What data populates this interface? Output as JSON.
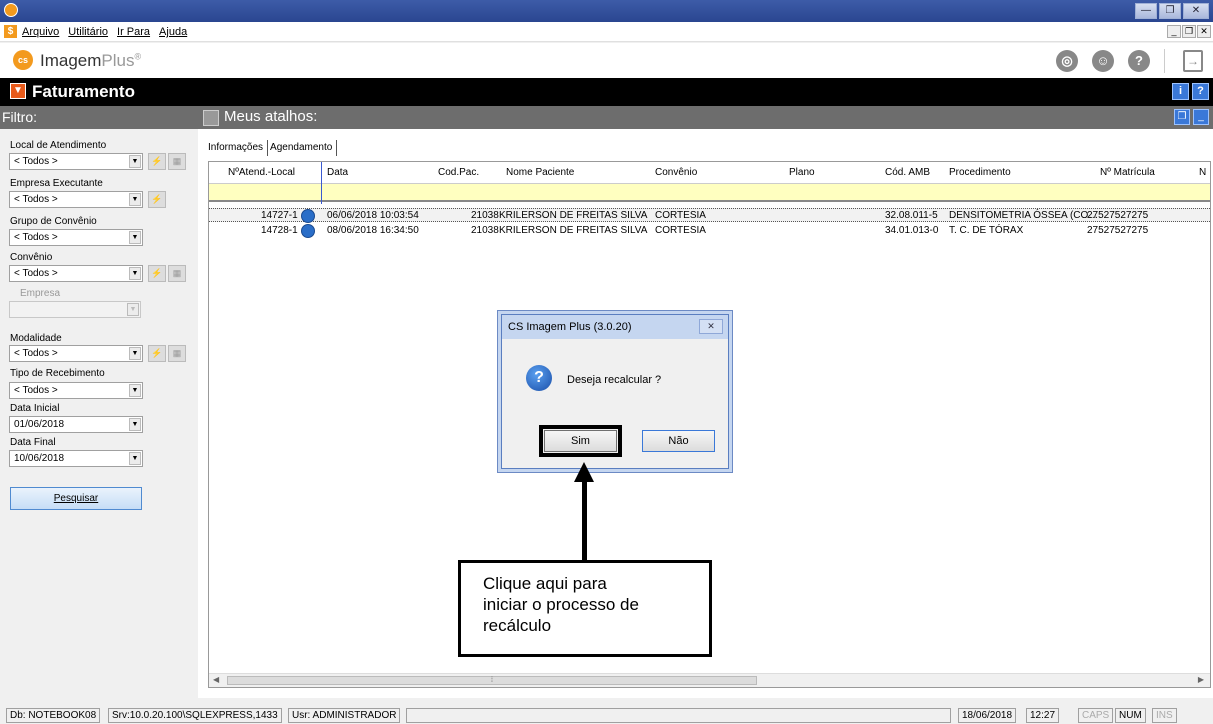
{
  "menu": {
    "items": [
      "Arquivo",
      "Utilitário",
      "Ir Para",
      "Ajuda"
    ]
  },
  "brand": {
    "name": "Imagem",
    "plus": "Plus",
    "reg": "®"
  },
  "module": {
    "title": "Faturamento"
  },
  "filter": {
    "heading": "Filtro:",
    "local_label": "Local de Atendimento",
    "local_value": "< Todos >",
    "empresa_exec_label": "Empresa Executante",
    "empresa_exec_value": "< Todos >",
    "grupo_label": "Grupo de Convênio",
    "grupo_value": "< Todos >",
    "convenio_label": "Convênio",
    "convenio_value": "< Todos >",
    "empresa_label": "Empresa",
    "modalidade_label": "Modalidade",
    "modalidade_value": "< Todos >",
    "tipo_label": "Tipo de Recebimento",
    "tipo_value": "< Todos >",
    "data_inicial_label": "Data Inicial",
    "data_inicial_value": "01/06/2018",
    "data_final_label": "Data Final",
    "data_final_value": "10/06/2018",
    "search_label": "Pesquisar"
  },
  "main": {
    "heading": "Meus atalhos:",
    "tabs": [
      "Informações",
      "Agendamento"
    ],
    "columns": [
      "NºAtend.-Local",
      "Data",
      "Cod.Pac.",
      "Nome Paciente",
      "Convênio",
      "Plano",
      "Cód. AMB",
      "Procedimento",
      "Nº Matrícula",
      "N"
    ],
    "rows": [
      {
        "atend": "14727-1",
        "data": "06/06/2018 10:03:54",
        "codpac": "21038",
        "nome": "KRILERSON DE FREITAS SILVA",
        "convenio": "CORTESIA",
        "plano": "",
        "amb": "32.08.011-5",
        "proc": "DENSITOMETRIA ÓSSEA (CO…",
        "matricula": "27527527275"
      },
      {
        "atend": "14728-1",
        "data": "08/06/2018 16:34:50",
        "codpac": "21038",
        "nome": "KRILERSON DE FREITAS SILVA",
        "convenio": "CORTESIA",
        "plano": "",
        "amb": "34.01.013-0",
        "proc": "T. C. DE TÓRAX",
        "matricula": "27527527275"
      }
    ]
  },
  "dialog": {
    "title": "CS Imagem Plus (3.0.20)",
    "message": "Deseja recalcular ?",
    "yes": "Sim",
    "no": "Não"
  },
  "callout": {
    "line1": "Clique aqui para",
    "line2": "iniciar o processo de",
    "line3": "recálculo"
  },
  "status": {
    "db": "Db: NOTEBOOK08",
    "srv": "Srv:10.0.20.100\\SQLEXPRESS,1433",
    "usr": "Usr: ADMINISTRADOR",
    "date": "18/06/2018",
    "time": "12:27",
    "caps": "CAPS",
    "num": "NUM",
    "ins": "INS"
  }
}
